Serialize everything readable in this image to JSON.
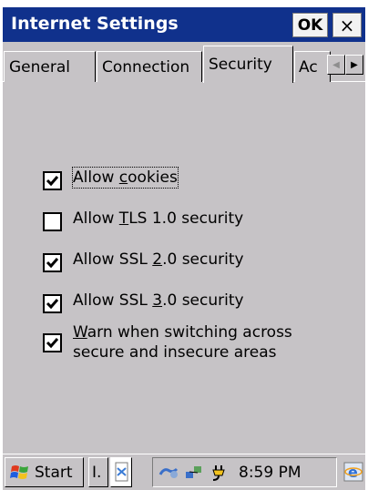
{
  "window": {
    "title": "Internet Settings",
    "ok_label": "OK",
    "close_label": "×"
  },
  "tabs": {
    "items": [
      {
        "label": "General"
      },
      {
        "label": "Connection"
      },
      {
        "label": "Security",
        "selected": true
      },
      {
        "label": "Ac"
      }
    ],
    "scroll_left": "◀",
    "scroll_right": "▶"
  },
  "options": [
    {
      "label": "Allow cookies",
      "mnemonic": "c",
      "checked": true,
      "focused": true
    },
    {
      "label": "Allow TLS 1.0 security",
      "mnemonic": "T",
      "checked": false
    },
    {
      "label": "Allow SSL 2.0 security",
      "mnemonic": "2",
      "checked": true
    },
    {
      "label": "Allow SSL 3.0 security",
      "mnemonic": "3",
      "checked": true
    },
    {
      "label": "Warn when switching across secure and insecure areas",
      "mnemonic": "W",
      "checked": true
    }
  ],
  "taskbar": {
    "start_label": "Start",
    "task_1_label": "I.",
    "clock": "8:59 PM",
    "icons": [
      "windows-flag-icon",
      "document-icon",
      "network-icon",
      "connection-icon",
      "power-plug-icon",
      "internet-explorer-icon"
    ]
  },
  "colors": {
    "titlebar": "#10318c",
    "face": "#c6c3c6"
  }
}
